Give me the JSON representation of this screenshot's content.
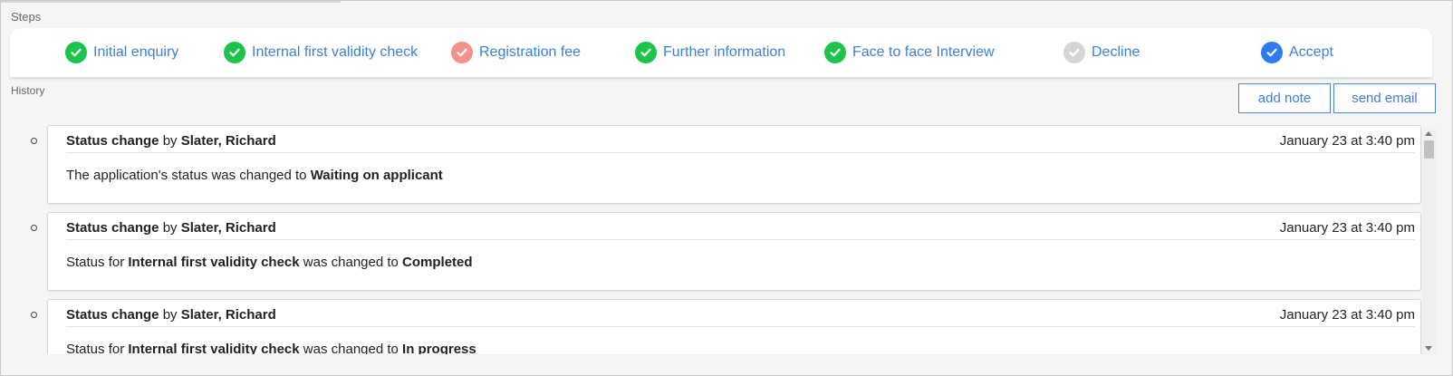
{
  "steps_label": "Steps",
  "history_label": "History",
  "steps": [
    {
      "label": "Initial enquiry",
      "status": "completed",
      "color": "#1dc449"
    },
    {
      "label": "Internal first validity check",
      "status": "completed",
      "color": "#1dc449"
    },
    {
      "label": "Registration fee",
      "status": "in-progress",
      "color": "#f4918a"
    },
    {
      "label": "Further information",
      "status": "completed",
      "color": "#1dc449"
    },
    {
      "label": "Face to face Interview",
      "status": "completed",
      "color": "#1dc449"
    },
    {
      "label": "Decline",
      "status": "inactive",
      "color": "#d5d5d5"
    },
    {
      "label": "Accept",
      "status": "current",
      "color": "#2d7bf0"
    }
  ],
  "buttons": {
    "add_note": "add note",
    "send_email": "send email"
  },
  "history": [
    {
      "type": "Status change",
      "by_word": "by",
      "author": "Slater, Richard",
      "time": "January 23 at 3:40 pm",
      "body": [
        {
          "text": "The application's status was changed to ",
          "bold": false
        },
        {
          "text": "Waiting on applicant",
          "bold": true
        }
      ]
    },
    {
      "type": "Status change",
      "by_word": "by",
      "author": "Slater, Richard",
      "time": "January 23 at 3:40 pm",
      "body": [
        {
          "text": "Status for ",
          "bold": false
        },
        {
          "text": "Internal first validity check",
          "bold": true
        },
        {
          "text": " was changed to ",
          "bold": false
        },
        {
          "text": "Completed",
          "bold": true
        }
      ]
    },
    {
      "type": "Status change",
      "by_word": "by",
      "author": "Slater, Richard",
      "time": "January 23 at 3:40 pm",
      "body": [
        {
          "text": "Status for ",
          "bold": false
        },
        {
          "text": "Internal first validity check",
          "bold": true
        },
        {
          "text": " was changed to ",
          "bold": false
        },
        {
          "text": "In progress",
          "bold": true
        }
      ]
    }
  ]
}
